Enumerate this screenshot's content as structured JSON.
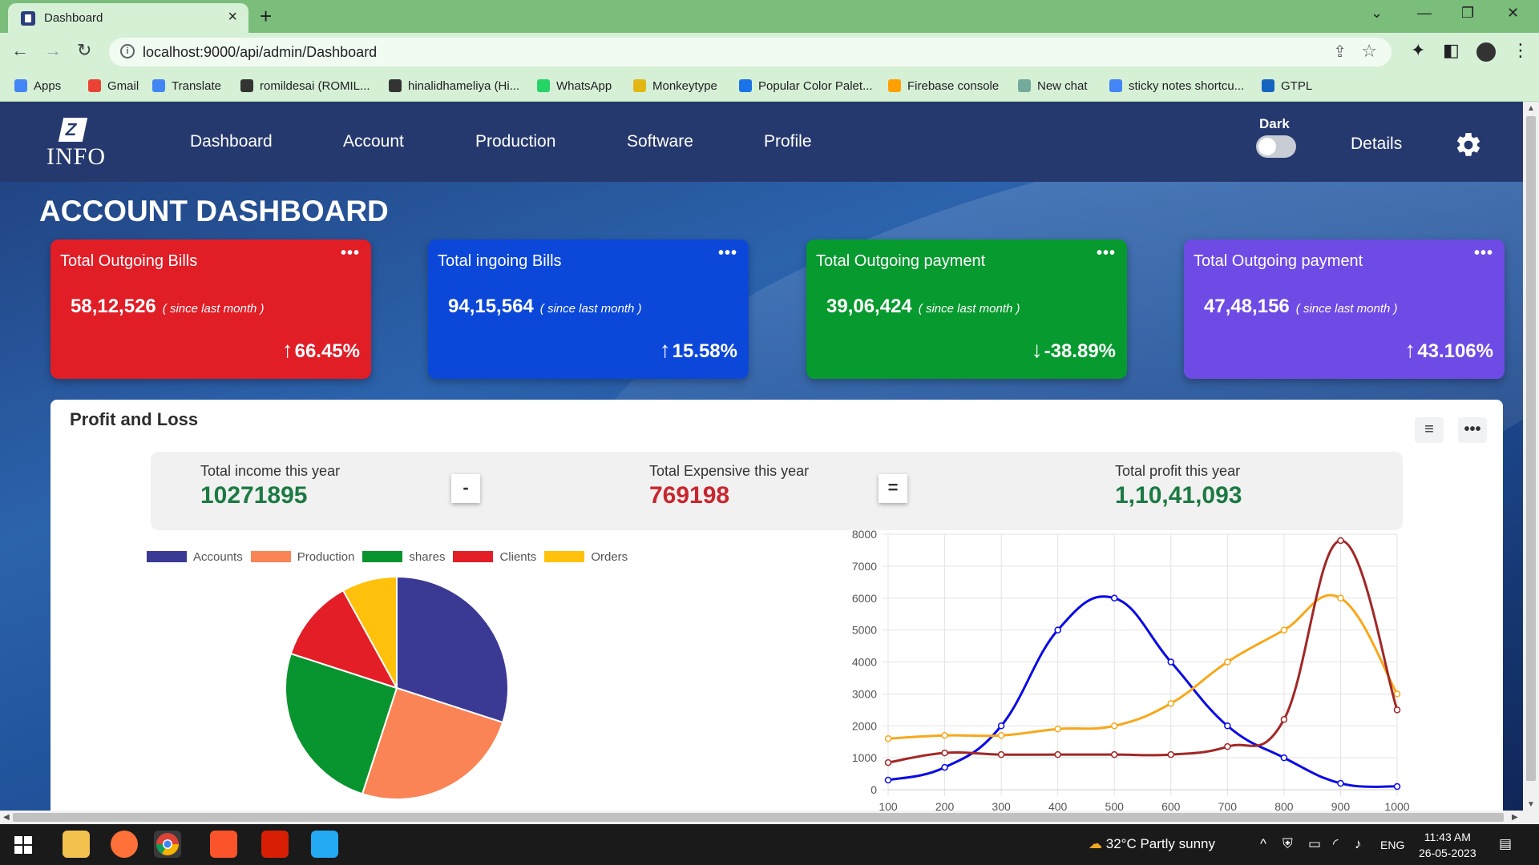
{
  "browser": {
    "tab_title": "Dashboard",
    "url": "localhost:9000/api/admin/Dashboard",
    "bookmarks": [
      {
        "label": "Apps",
        "color": "#4285f4"
      },
      {
        "label": "Gmail",
        "color": "#ea4335"
      },
      {
        "label": "Translate",
        "color": "#4285f4"
      },
      {
        "label": "romildesai (ROMIL...",
        "color": "#333333"
      },
      {
        "label": "hinalidhameliya (Hi...",
        "color": "#333333"
      },
      {
        "label": "WhatsApp",
        "color": "#25d366"
      },
      {
        "label": "Monkeytype",
        "color": "#e2b714"
      },
      {
        "label": "Popular Color Palet...",
        "color": "#1a73e8"
      },
      {
        "label": "Firebase console",
        "color": "#ffa000"
      },
      {
        "label": "New chat",
        "color": "#74aa9c"
      },
      {
        "label": "sticky notes shortcu...",
        "color": "#4285f4"
      },
      {
        "label": "GTPL",
        "color": "#1565c0"
      }
    ]
  },
  "navbar": {
    "logo_text": "INFO",
    "links": [
      "Dashboard",
      "Account",
      "Production",
      "Software",
      "Profile"
    ],
    "dark_label": "Dark",
    "details_label": "Details"
  },
  "page_title": "ACCOUNT DASHBOARD",
  "cards": [
    {
      "title": "Total Outgoing Bills",
      "value": "58,12,526",
      "since": "( since last month )",
      "trend": "66.45%",
      "direction": "up",
      "color": "#e11d26"
    },
    {
      "title": "Total ingoing Bills",
      "value": "94,15,564",
      "since": "( since last month )",
      "trend": "15.58%",
      "direction": "up",
      "color": "#0b47d9"
    },
    {
      "title": "Total Outgoing payment",
      "value": "39,06,424",
      "since": "( since last month )",
      "trend": "-38.89%",
      "direction": "down",
      "color": "#079a2f"
    },
    {
      "title": "Total Outgoing payment",
      "value": "47,48,156",
      "since": "( since last month )",
      "trend": "43.106%",
      "direction": "up",
      "color": "#6f4be6"
    }
  ],
  "card_dots": "•••",
  "panel": {
    "title": "Profit and Loss",
    "summary": {
      "income_label": "Total income this year",
      "income_value": "10271895",
      "minus": "-",
      "expense_label": "Total Expensive this year",
      "expense_value": "769198",
      "equals": "=",
      "profit_label": "Total profit this year",
      "profit_value": "1,10,41,093"
    }
  },
  "chart_data": [
    {
      "type": "pie",
      "categories": [
        "Accounts",
        "Production",
        "shares",
        "Clients",
        "Orders"
      ],
      "values": [
        30,
        25,
        25,
        12,
        8
      ],
      "colors": [
        "#3a3a94",
        "#fa8455",
        "#08942e",
        "#e31e26",
        "#ffc10c"
      ],
      "legend": "top"
    },
    {
      "type": "line",
      "x": [
        100,
        200,
        300,
        400,
        500,
        600,
        700,
        800,
        900,
        1000
      ],
      "ylim": [
        0,
        8000
      ],
      "xlim": [
        100,
        1000
      ],
      "yticks": [
        0,
        1000,
        2000,
        3000,
        4000,
        5000,
        6000,
        7000,
        8000
      ],
      "grid": true,
      "series": [
        {
          "color": "#0a0ae6",
          "values": [
            300,
            700,
            2000,
            5000,
            6000,
            4000,
            2000,
            1000,
            200,
            100
          ]
        },
        {
          "color": "#f7a81b",
          "values": [
            1600,
            1700,
            1700,
            1900,
            2000,
            2700,
            4000,
            5000,
            6000,
            3000
          ]
        },
        {
          "color": "#a02826",
          "values": [
            850,
            1150,
            1100,
            1100,
            1100,
            1100,
            1350,
            2200,
            7800,
            2500
          ]
        }
      ]
    }
  ],
  "taskbar": {
    "weather": "32°C  Partly sunny",
    "lang": "ENG",
    "time": "11:43 AM",
    "date": "26-05-2023"
  }
}
